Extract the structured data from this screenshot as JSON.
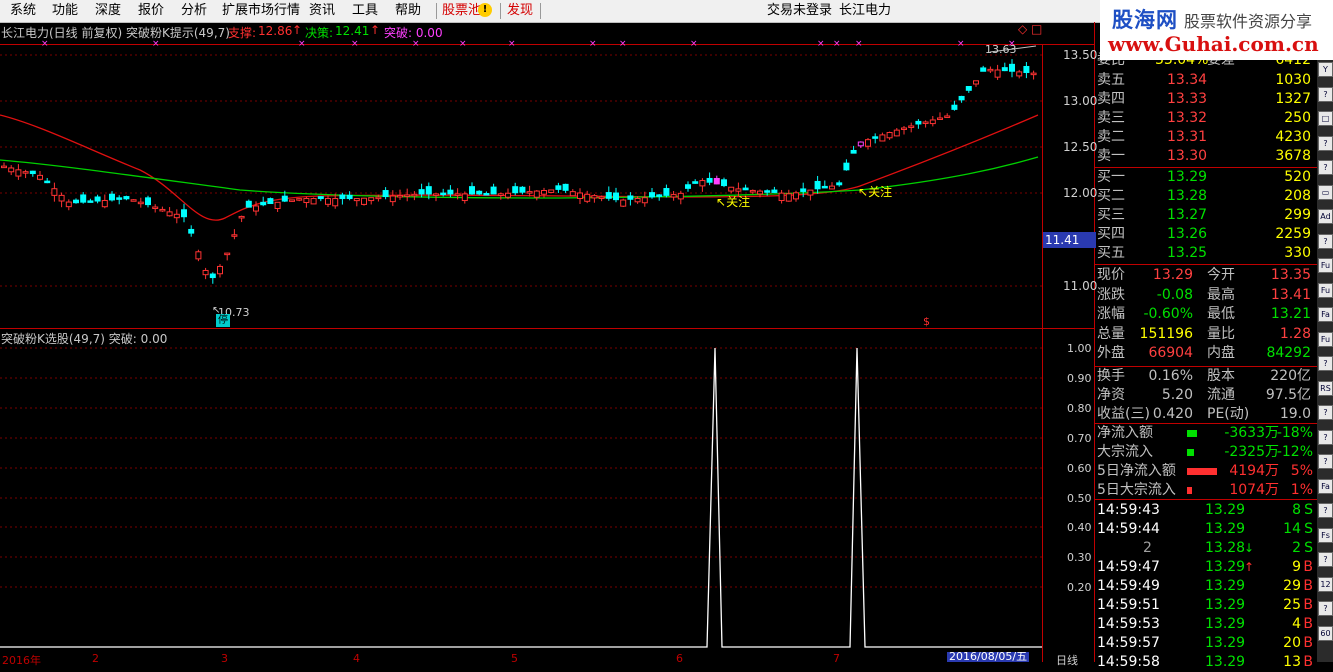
{
  "menu": {
    "items": [
      "系统",
      "功能",
      "深度",
      "报价",
      "分析",
      "扩展市场行情",
      "资讯",
      "工具",
      "帮助"
    ],
    "stock_pool": "股票池",
    "discover": "发现",
    "login_status": "交易未登录",
    "stock_name": "长江电力"
  },
  "logo": {
    "brand": "股海网",
    "slogan": "股票软件资源分享",
    "url": "www.Guhai.com.cn"
  },
  "chart_header": {
    "title": "长江电力(日线 前复权) 突破粉K提示(49,7)",
    "support_label": "支撑:",
    "support_value": "12.86",
    "decision_label": "决策:",
    "decision_value": "12.41",
    "breakthrough": "突破: 0.00"
  },
  "indicator_header": "突破粉K选股(49,7) 突破: 0.00",
  "annotations": {
    "high_label": "13.63",
    "low_label": "10.73",
    "attention_1": "关注",
    "attention_2": "关注",
    "stop_badge": "停",
    "dollar_mark": "$",
    "current_price_tag": "11.41",
    "top_icons": "◇ □"
  },
  "price_axis": [
    "13.50",
    "13.00",
    "12.50",
    "12.00",
    "11.00"
  ],
  "indicator_axis": [
    "1.00",
    "0.90",
    "0.80",
    "0.70",
    "0.60",
    "0.50",
    "0.40",
    "0.30",
    "0.20"
  ],
  "time_axis": {
    "labels": [
      "2016年",
      "2",
      "3",
      "4",
      "5",
      "6",
      "7"
    ],
    "current_date": "2016/08/05/五",
    "period": "日线"
  },
  "order_book": {
    "top_row": {
      "label": "委比",
      "value": "33.04%",
      "label2": "委差",
      "value2": "6412"
    },
    "asks": [
      {
        "label": "卖五",
        "price": "13.34",
        "volume": "1030"
      },
      {
        "label": "卖四",
        "price": "13.33",
        "volume": "1327"
      },
      {
        "label": "卖三",
        "price": "13.32",
        "volume": "250"
      },
      {
        "label": "卖二",
        "price": "13.31",
        "volume": "4230"
      },
      {
        "label": "卖一",
        "price": "13.30",
        "volume": "3678"
      }
    ],
    "bids": [
      {
        "label": "买一",
        "price": "13.29",
        "volume": "520"
      },
      {
        "label": "买二",
        "price": "13.28",
        "volume": "208"
      },
      {
        "label": "买三",
        "price": "13.27",
        "volume": "299"
      },
      {
        "label": "买四",
        "price": "13.26",
        "volume": "2259"
      },
      {
        "label": "买五",
        "price": "13.25",
        "volume": "330"
      }
    ]
  },
  "quote": [
    {
      "l1": "现价",
      "v1": "13.29",
      "c1": "#ff4040",
      "l2": "今开",
      "v2": "13.35",
      "c2": "#ff4040"
    },
    {
      "l1": "涨跌",
      "v1": "-0.08",
      "c1": "#00e000",
      "l2": "最高",
      "v2": "13.41",
      "c2": "#ff4040"
    },
    {
      "l1": "涨幅",
      "v1": "-0.60%",
      "c1": "#00e000",
      "l2": "最低",
      "v2": "13.21",
      "c2": "#00e000"
    },
    {
      "l1": "总量",
      "v1": "151196",
      "c1": "#ffff00",
      "l2": "量比",
      "v2": "1.28",
      "c2": "#ff4040"
    },
    {
      "l1": "外盘",
      "v1": "66904",
      "c1": "#ff4040",
      "l2": "内盘",
      "v2": "84292",
      "c2": "#00e000"
    }
  ],
  "fundamentals": [
    {
      "l1": "换手",
      "v1": "0.16%",
      "l2": "股本",
      "v2": "220亿"
    },
    {
      "l1": "净资",
      "v1": "5.20",
      "l2": "流通",
      "v2": "97.5亿"
    },
    {
      "l1": "收益(三)",
      "v1": "0.420",
      "l2": "PE(动)",
      "v2": "19.0"
    }
  ],
  "flows": [
    {
      "label": "净流入额",
      "amount": "-3633万",
      "pct": "-18%",
      "color": "#00e000",
      "bar": 0.18
    },
    {
      "label": "大宗流入",
      "amount": "-2325万",
      "pct": "-12%",
      "color": "#00e000",
      "bar": 0.12
    },
    {
      "label": "5日净流入额",
      "amount": "4194万",
      "pct": "5%",
      "color": "#ff3030",
      "bar": 0.55
    },
    {
      "label": "5日大宗流入",
      "amount": "1074万",
      "pct": "1%",
      "color": "#ff3030",
      "bar": 0.08
    }
  ],
  "ticks": [
    {
      "time": "14:59:43",
      "price": "13.29",
      "vol": "8",
      "side": "S",
      "arrow": ""
    },
    {
      "time": "14:59:44",
      "price": "13.29",
      "vol": "14",
      "side": "S",
      "arrow": ""
    },
    {
      "time": "2",
      "price": "13.28",
      "vol": "2",
      "side": "S",
      "arrow": "↓"
    },
    {
      "time": "14:59:47",
      "price": "13.29",
      "vol": "9",
      "side": "B",
      "arrow": "↑"
    },
    {
      "time": "14:59:49",
      "price": "13.29",
      "vol": "29",
      "side": "B",
      "arrow": ""
    },
    {
      "time": "14:59:51",
      "price": "13.29",
      "vol": "25",
      "side": "B",
      "arrow": ""
    },
    {
      "time": "14:59:53",
      "price": "13.29",
      "vol": "4",
      "side": "B",
      "arrow": ""
    },
    {
      "time": "14:59:57",
      "price": "13.29",
      "vol": "20",
      "side": "B",
      "arrow": ""
    },
    {
      "time": "14:59:58",
      "price": "13.29",
      "vol": "13",
      "side": "B",
      "arrow": ""
    }
  ],
  "sidebar_icons": [
    "Y",
    "?",
    "□",
    "?",
    "?",
    "▭",
    "Ad",
    "?",
    "Fu",
    "Fu",
    "Fa",
    "Fu",
    "?",
    "RS",
    "?",
    "?",
    "?",
    "Fa",
    "?",
    "Fs",
    "?",
    "12",
    "?",
    "60"
  ],
  "colors": {
    "up": "#ff3333",
    "down": "#00ffff",
    "ma_short": "#e01010",
    "ma_long": "#00d000",
    "accent_pink": "#ff40ff"
  }
}
